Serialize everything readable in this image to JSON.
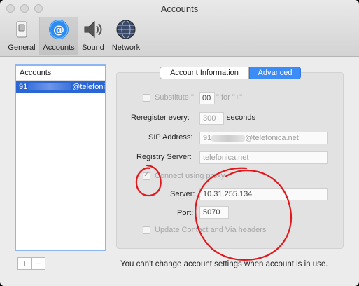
{
  "window": {
    "title": "Accounts"
  },
  "toolbar": {
    "items": [
      {
        "label": "General",
        "icon": "general-switch-icon"
      },
      {
        "label": "Accounts",
        "icon": "at-sign-icon"
      },
      {
        "label": "Sound",
        "icon": "speaker-icon"
      },
      {
        "label": "Network",
        "icon": "globe-icon"
      }
    ],
    "active": "Accounts"
  },
  "accounts": {
    "header": "Accounts",
    "selected": {
      "prefix": "91",
      "suffix": "@telefonica.net"
    },
    "add_label": "+",
    "remove_label": "−"
  },
  "tabs": {
    "account_info": "Account Information",
    "advanced": "Advanced",
    "active": "Advanced"
  },
  "advanced": {
    "substitute": {
      "label_pre": "Substitute \"",
      "value": "00",
      "label_post": "\" for \"+\"",
      "checked": false
    },
    "reregister": {
      "label": "Reregister every:",
      "placeholder": "300",
      "unit": "seconds"
    },
    "sip_address": {
      "label": "SIP Address:",
      "prefix": "91",
      "suffix": "@telefonica.net"
    },
    "registry_server": {
      "label": "Registry Server:",
      "placeholder": "telefonica.net"
    },
    "connect_proxy": {
      "label": "Connect using proxy",
      "checked": true
    },
    "server": {
      "label": "Server:",
      "value": "10.31.255.134"
    },
    "port": {
      "label": "Port:",
      "value": "5070"
    },
    "update_headers": {
      "label": "Update Contact and Via headers",
      "checked": false
    }
  },
  "footer": {
    "message": "You can't change account settings when account is in use."
  },
  "colors": {
    "accent": "#3b8cf7",
    "selection": "#2b66d6",
    "annotation": "#e0191f"
  }
}
